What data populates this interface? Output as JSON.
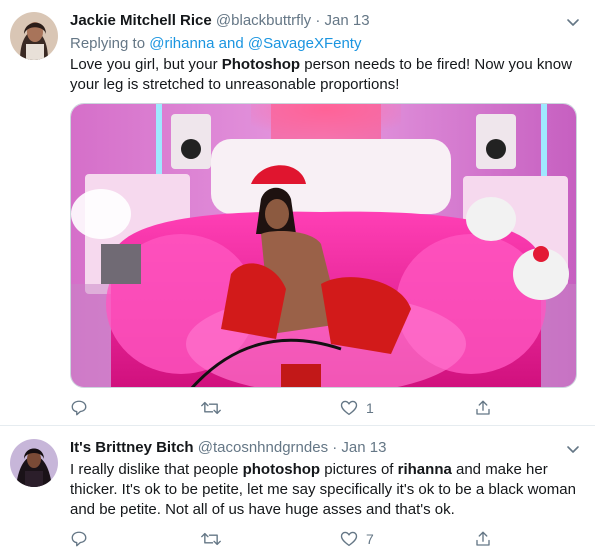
{
  "tweets": [
    {
      "display_name": "Jackie Mitchell Rice",
      "handle": "@blackbuttrfly",
      "separator": "·",
      "date": "Jan 13",
      "replying_prefix": "Replying to",
      "replying_mentions": "@rihanna and @SavageXFenty",
      "text_before": "Love you girl, but your ",
      "text_bold": "Photoshop",
      "text_after": " person needs to be fired! Now you know your leg is stretched to unreasonable proportions!",
      "reply_count": "",
      "retweet_count": "",
      "like_count": "1"
    },
    {
      "display_name": "It's Brittney Bitch",
      "handle": "@tacosnhndgrndes",
      "separator": "·",
      "date": "Jan 13",
      "text_1": "I really dislike that people ",
      "text_2": "photoshop",
      "text_3": " pictures of ",
      "text_4": "rihanna",
      "text_5": " and make her thicker. It's ok to be petite, let me say specifically it's ok to be a black woman and be petite. Not all of us have huge asses and that's ok.",
      "retweet_count": "",
      "like_count": "7"
    }
  ],
  "colors": {
    "text": "#14171a",
    "muted": "#657786",
    "link": "#1b95e0",
    "divider": "#e6ecf0"
  },
  "icons": [
    "reply-icon",
    "retweet-icon",
    "like-icon",
    "share-icon",
    "chevron-down-icon"
  ]
}
